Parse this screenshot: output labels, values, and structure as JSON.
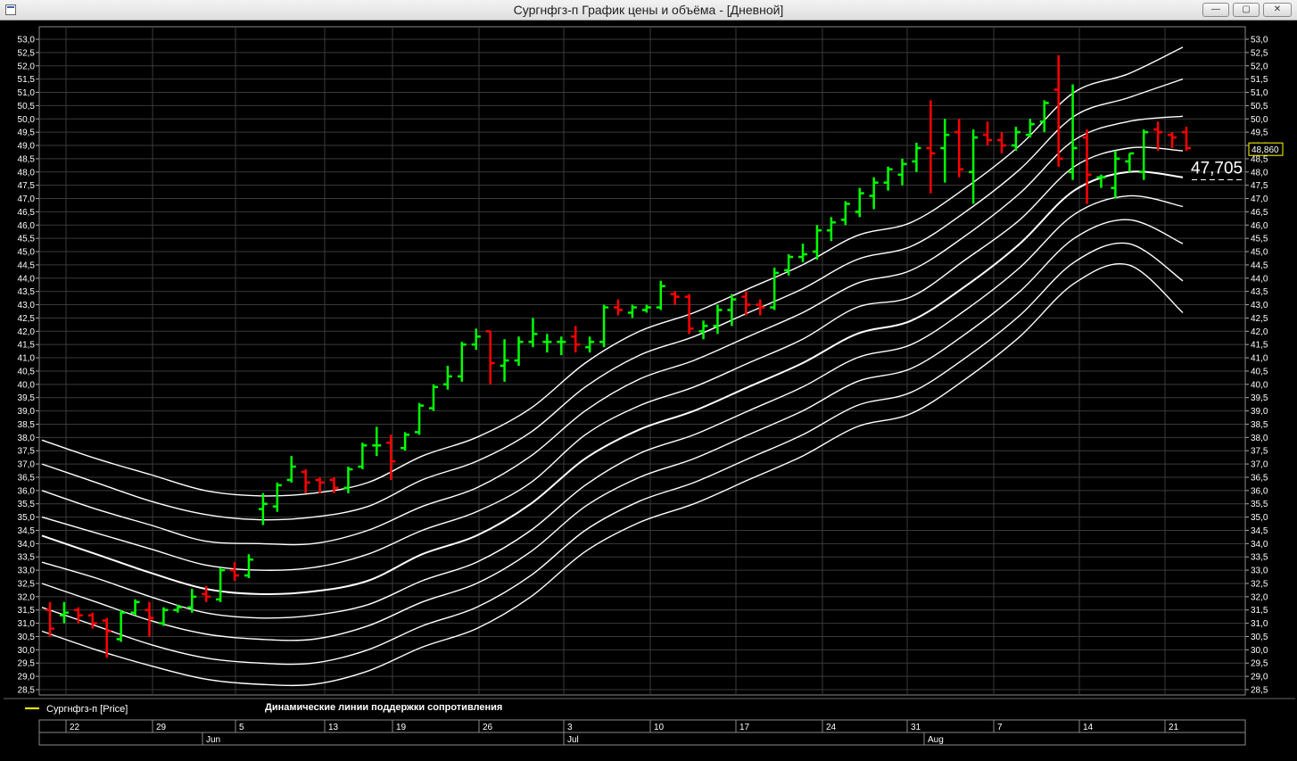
{
  "window": {
    "title": "Сургнфгз-п График цены и объёма - [Дневной]",
    "minimize_label": "—",
    "restore_label": "▢",
    "close_label": "✕"
  },
  "legend": {
    "series_label": "Сургнфгз-п [Price]",
    "indicator_label": "Динамические линии поддержки  сопротивления",
    "marker_color": "#ffff00"
  },
  "price_labels": {
    "last_price": "48,860",
    "level_value": "47,705"
  },
  "colors": {
    "up": "#00ff00",
    "down": "#ff0000",
    "bands": "#ffffff",
    "grid": "#3a3a3a",
    "last_price_border": "#ffff00"
  },
  "chart_data": {
    "type": "ohlc",
    "ylim": [
      28.5,
      53.0
    ],
    "y_tick_step": 0.5,
    "grid": true,
    "axes_side": "both",
    "x_day_labels": [
      "22",
      "29",
      "5",
      "13",
      "19",
      "26",
      "3",
      "10",
      "17",
      "24",
      "31",
      "7",
      "14",
      "21"
    ],
    "x_month_labels": [
      "Jun",
      "Jul",
      "Aug"
    ],
    "bars": [
      {
        "o": 31.5,
        "h": 31.8,
        "l": 30.5,
        "c": 30.8
      },
      {
        "o": 31.3,
        "h": 31.8,
        "l": 31.0,
        "c": 31.4
      },
      {
        "o": 31.5,
        "h": 31.6,
        "l": 31.0,
        "c": 31.3
      },
      {
        "o": 31.3,
        "h": 31.4,
        "l": 30.8,
        "c": 31.0
      },
      {
        "o": 31.1,
        "h": 31.2,
        "l": 29.7,
        "c": 30.7
      },
      {
        "o": 30.4,
        "h": 31.5,
        "l": 30.3,
        "c": 31.4
      },
      {
        "o": 31.4,
        "h": 31.9,
        "l": 31.3,
        "c": 31.8
      },
      {
        "o": 31.5,
        "h": 31.8,
        "l": 30.5,
        "c": 31.2
      },
      {
        "o": 31.0,
        "h": 31.6,
        "l": 30.9,
        "c": 31.5
      },
      {
        "o": 31.5,
        "h": 31.7,
        "l": 31.4,
        "c": 31.6
      },
      {
        "o": 31.6,
        "h": 32.3,
        "l": 31.4,
        "c": 32.0
      },
      {
        "o": 32.1,
        "h": 32.4,
        "l": 31.8,
        "c": 32.0
      },
      {
        "o": 31.9,
        "h": 33.1,
        "l": 31.8,
        "c": 33.0
      },
      {
        "o": 33.0,
        "h": 33.3,
        "l": 32.6,
        "c": 32.8
      },
      {
        "o": 32.8,
        "h": 33.6,
        "l": 32.7,
        "c": 33.4
      },
      {
        "o": 35.3,
        "h": 35.9,
        "l": 34.7,
        "c": 35.5
      },
      {
        "o": 35.4,
        "h": 36.3,
        "l": 35.2,
        "c": 36.2
      },
      {
        "o": 36.4,
        "h": 37.3,
        "l": 36.3,
        "c": 36.9
      },
      {
        "o": 36.7,
        "h": 36.8,
        "l": 35.9,
        "c": 36.3
      },
      {
        "o": 36.4,
        "h": 36.5,
        "l": 35.9,
        "c": 36.3
      },
      {
        "o": 36.4,
        "h": 36.5,
        "l": 35.9,
        "c": 36.1
      },
      {
        "o": 36.1,
        "h": 36.9,
        "l": 35.9,
        "c": 36.8
      },
      {
        "o": 36.9,
        "h": 37.8,
        "l": 36.8,
        "c": 37.7
      },
      {
        "o": 37.7,
        "h": 38.4,
        "l": 37.3,
        "c": 37.7
      },
      {
        "o": 37.8,
        "h": 38.1,
        "l": 36.4,
        "c": 37.1
      },
      {
        "o": 37.6,
        "h": 38.2,
        "l": 37.5,
        "c": 38.1
      },
      {
        "o": 38.2,
        "h": 39.3,
        "l": 38.1,
        "c": 39.2
      },
      {
        "o": 39.1,
        "h": 40.0,
        "l": 39.0,
        "c": 39.9
      },
      {
        "o": 40.0,
        "h": 40.7,
        "l": 39.8,
        "c": 40.3
      },
      {
        "o": 40.3,
        "h": 41.6,
        "l": 40.1,
        "c": 41.5
      },
      {
        "o": 41.5,
        "h": 42.1,
        "l": 41.3,
        "c": 41.8
      },
      {
        "o": 42.0,
        "h": 42.0,
        "l": 40.0,
        "c": 40.8
      },
      {
        "o": 40.7,
        "h": 41.7,
        "l": 40.1,
        "c": 40.9
      },
      {
        "o": 40.9,
        "h": 41.8,
        "l": 40.7,
        "c": 41.6
      },
      {
        "o": 41.6,
        "h": 42.5,
        "l": 41.4,
        "c": 41.9
      },
      {
        "o": 41.6,
        "h": 41.9,
        "l": 41.2,
        "c": 41.6
      },
      {
        "o": 41.6,
        "h": 41.8,
        "l": 41.1,
        "c": 41.6
      },
      {
        "o": 41.8,
        "h": 42.2,
        "l": 41.2,
        "c": 41.5
      },
      {
        "o": 41.4,
        "h": 41.8,
        "l": 41.2,
        "c": 41.6
      },
      {
        "o": 41.6,
        "h": 43.0,
        "l": 41.4,
        "c": 42.9
      },
      {
        "o": 42.9,
        "h": 43.2,
        "l": 42.6,
        "c": 42.8
      },
      {
        "o": 42.7,
        "h": 43.0,
        "l": 42.5,
        "c": 42.9
      },
      {
        "o": 42.8,
        "h": 43.0,
        "l": 42.7,
        "c": 42.9
      },
      {
        "o": 42.9,
        "h": 43.9,
        "l": 42.8,
        "c": 43.7
      },
      {
        "o": 43.4,
        "h": 43.5,
        "l": 43.0,
        "c": 43.3
      },
      {
        "o": 43.3,
        "h": 43.4,
        "l": 41.9,
        "c": 42.1
      },
      {
        "o": 42.0,
        "h": 42.4,
        "l": 41.7,
        "c": 42.2
      },
      {
        "o": 42.2,
        "h": 43.0,
        "l": 41.9,
        "c": 42.8
      },
      {
        "o": 42.8,
        "h": 43.4,
        "l": 42.2,
        "c": 43.2
      },
      {
        "o": 43.3,
        "h": 43.5,
        "l": 42.6,
        "c": 43.0
      },
      {
        "o": 43.0,
        "h": 43.2,
        "l": 42.6,
        "c": 42.9
      },
      {
        "o": 42.9,
        "h": 44.4,
        "l": 42.8,
        "c": 44.2
      },
      {
        "o": 44.3,
        "h": 44.9,
        "l": 44.1,
        "c": 44.8
      },
      {
        "o": 44.8,
        "h": 45.3,
        "l": 44.6,
        "c": 44.9
      },
      {
        "o": 45.0,
        "h": 46.0,
        "l": 44.7,
        "c": 45.8
      },
      {
        "o": 45.8,
        "h": 46.3,
        "l": 45.4,
        "c": 46.1
      },
      {
        "o": 46.2,
        "h": 46.9,
        "l": 46.0,
        "c": 46.8
      },
      {
        "o": 46.5,
        "h": 47.4,
        "l": 46.3,
        "c": 47.2
      },
      {
        "o": 47.1,
        "h": 47.8,
        "l": 46.6,
        "c": 47.6
      },
      {
        "o": 47.6,
        "h": 48.2,
        "l": 47.3,
        "c": 48.1
      },
      {
        "o": 47.9,
        "h": 48.5,
        "l": 47.5,
        "c": 48.3
      },
      {
        "o": 48.4,
        "h": 49.1,
        "l": 48.0,
        "c": 48.9
      },
      {
        "o": 48.9,
        "h": 50.7,
        "l": 47.2,
        "c": 48.7
      },
      {
        "o": 48.9,
        "h": 50.0,
        "l": 47.6,
        "c": 49.4
      },
      {
        "o": 49.5,
        "h": 50.0,
        "l": 47.8,
        "c": 48.1
      },
      {
        "o": 48.0,
        "h": 49.6,
        "l": 46.8,
        "c": 49.3
      },
      {
        "o": 49.4,
        "h": 49.9,
        "l": 49.0,
        "c": 49.2
      },
      {
        "o": 49.2,
        "h": 49.5,
        "l": 48.7,
        "c": 49.0
      },
      {
        "o": 49.0,
        "h": 49.7,
        "l": 48.8,
        "c": 49.5
      },
      {
        "o": 49.4,
        "h": 50.0,
        "l": 49.3,
        "c": 49.8
      },
      {
        "o": 49.9,
        "h": 50.7,
        "l": 49.5,
        "c": 50.6
      },
      {
        "o": 51.1,
        "h": 52.4,
        "l": 48.2,
        "c": 48.5
      },
      {
        "o": 48.0,
        "h": 51.3,
        "l": 47.7,
        "c": 48.9
      },
      {
        "o": 49.3,
        "h": 49.6,
        "l": 46.8,
        "c": 47.9
      },
      {
        "o": 47.8,
        "h": 47.9,
        "l": 47.4,
        "c": 47.8
      },
      {
        "o": 47.4,
        "h": 48.8,
        "l": 47.0,
        "c": 48.5
      },
      {
        "o": 48.4,
        "h": 48.7,
        "l": 48.0,
        "c": 48.7
      },
      {
        "o": 48.0,
        "h": 49.6,
        "l": 47.7,
        "c": 49.5
      },
      {
        "o": 49.6,
        "h": 49.9,
        "l": 48.8,
        "c": 49.5
      },
      {
        "o": 49.4,
        "h": 49.5,
        "l": 48.9,
        "c": 49.3
      },
      {
        "o": 49.5,
        "h": 49.7,
        "l": 48.8,
        "c": 48.9
      }
    ],
    "bands": [
      {
        "name": "",
        "values": [
          37.9,
          37.2,
          36.6,
          36.0,
          35.8,
          35.9,
          36.3,
          37.3,
          38.0,
          39.1,
          40.8,
          42.0,
          42.7,
          43.6,
          44.5,
          45.6,
          46.1,
          47.4,
          49.0,
          51.0,
          51.7,
          52.7
        ]
      },
      {
        "name": "",
        "values": [
          37.0,
          36.3,
          35.6,
          35.1,
          34.9,
          35.0,
          35.4,
          36.4,
          37.1,
          38.2,
          39.9,
          41.1,
          41.8,
          42.7,
          43.6,
          44.7,
          45.2,
          46.5,
          48.1,
          50.1,
          50.8,
          51.5
        ]
      },
      {
        "name": "",
        "values": [
          36.0,
          35.3,
          34.7,
          34.1,
          34.0,
          34.0,
          34.5,
          35.4,
          36.1,
          37.3,
          39.0,
          40.2,
          40.9,
          41.8,
          42.7,
          43.8,
          44.3,
          45.6,
          47.2,
          49.2,
          49.9,
          50.1
        ]
      },
      {
        "name": "",
        "values": [
          35.0,
          34.4,
          33.8,
          33.2,
          33.0,
          33.1,
          33.6,
          34.5,
          35.2,
          36.3,
          38.1,
          39.2,
          39.9,
          40.8,
          41.7,
          42.9,
          43.3,
          44.7,
          46.2,
          48.2,
          48.9,
          48.8
        ]
      },
      {
        "name": "",
        "values": [
          34.3,
          33.6,
          32.9,
          32.3,
          32.1,
          32.2,
          32.6,
          33.6,
          34.3,
          35.5,
          37.2,
          38.3,
          39.0,
          39.9,
          40.8,
          41.9,
          42.4,
          43.7,
          45.3,
          47.3,
          48.0,
          47.8
        ]
      },
      {
        "name": "",
        "values": [
          33.3,
          32.7,
          32.0,
          31.4,
          31.2,
          31.3,
          31.7,
          32.6,
          33.3,
          34.5,
          36.2,
          37.4,
          38.1,
          39.0,
          39.9,
          41.0,
          41.5,
          42.8,
          44.4,
          46.4,
          47.1,
          46.7
        ]
      },
      {
        "name": "",
        "values": [
          32.5,
          31.8,
          31.1,
          30.6,
          30.4,
          30.4,
          30.9,
          31.8,
          32.5,
          33.7,
          35.4,
          36.5,
          37.2,
          38.1,
          39.0,
          40.1,
          40.6,
          41.9,
          43.5,
          45.5,
          46.2,
          45.3
        ]
      },
      {
        "name": "",
        "values": [
          31.6,
          30.9,
          30.2,
          29.7,
          29.5,
          29.5,
          30.0,
          30.9,
          31.6,
          32.8,
          34.5,
          35.6,
          36.3,
          37.2,
          38.1,
          39.2,
          39.7,
          41.0,
          42.6,
          44.6,
          45.3,
          43.9
        ]
      },
      {
        "name": "",
        "values": [
          30.7,
          30.0,
          29.4,
          28.9,
          28.7,
          28.7,
          29.2,
          30.1,
          30.8,
          32.0,
          33.7,
          34.8,
          35.5,
          36.4,
          37.3,
          38.4,
          38.9,
          40.2,
          41.8,
          43.8,
          44.5,
          42.7
        ]
      }
    ]
  }
}
